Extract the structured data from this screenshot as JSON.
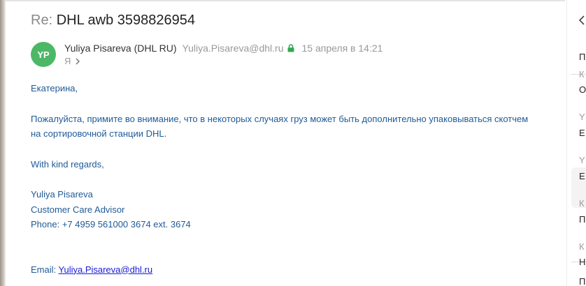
{
  "message": {
    "subject_prefix": "Re:",
    "subject": "DHL awb 3598826954",
    "avatar_initials": "YP",
    "sender_name": "Yuliya Pisareva (DHL RU)",
    "sender_email": "Yuliya.Pisareva@dhl.ru",
    "date": "15 апреля в 14:21",
    "recipient": "Я",
    "body": {
      "greeting": "Екатерина,",
      "para1_line1": "Пожалуйста, примите во внимание, что в некоторых случаях груз может быть дополнительно упаковываться скотчем",
      "para1_line2": "на сортировочной станции DHL.",
      "closing": "With kind regards,",
      "sig_name": "Yuliya Pisareva",
      "sig_title": "Customer Care Advisor",
      "sig_phone": "Phone: +7 4959 561000 3674 ext. 3674",
      "email_label": "Email:",
      "email_link": "Yuliya.Pisareva@dhl.ru"
    }
  },
  "thread_panel": {
    "items": [
      {
        "text": "П",
        "tone": "dark"
      },
      {
        "text": "К",
        "tone": "gray"
      },
      {
        "text": "О",
        "tone": "dark"
      },
      {
        "text": "Y",
        "tone": "gray"
      },
      {
        "text": "Е",
        "tone": "dark"
      },
      {
        "text": "Y",
        "tone": "gray"
      },
      {
        "text": "Е",
        "tone": "dark"
      },
      {
        "text": "К",
        "tone": "gray"
      },
      {
        "text": "П",
        "tone": "dark"
      },
      {
        "text": "К",
        "tone": "gray"
      },
      {
        "text": "Н",
        "tone": "dark"
      },
      {
        "text": "П",
        "tone": "dark"
      }
    ]
  },
  "colors": {
    "avatar": "#4cb866",
    "body_text": "#1f5a96",
    "link": "#1a1ad6",
    "lock": "#33a852"
  }
}
